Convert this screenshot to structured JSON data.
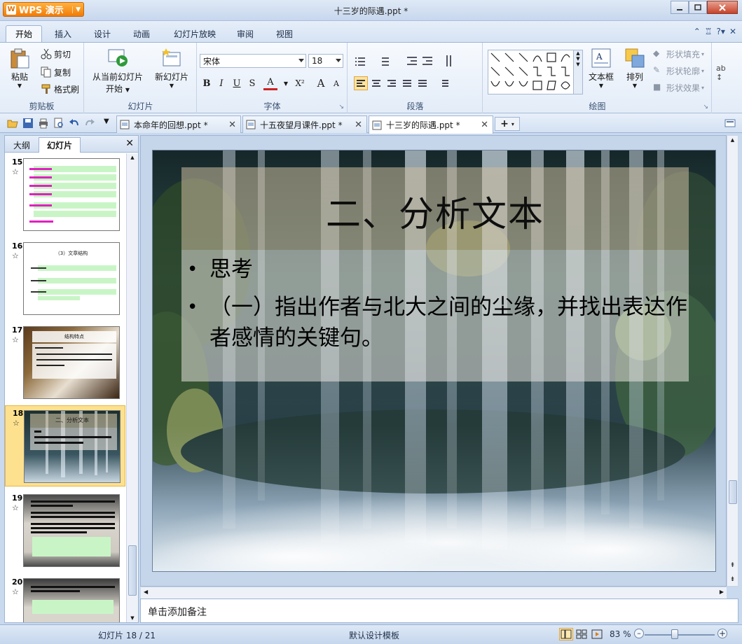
{
  "app": {
    "name": "WPS 演示",
    "logo_letter": "W",
    "window_title": "十三岁的际遇.ppt *"
  },
  "menu": {
    "tabs": [
      "开始",
      "插入",
      "设计",
      "动画",
      "幻灯片放映",
      "审阅",
      "视图"
    ],
    "active": "开始"
  },
  "ribbon": {
    "clipboard": {
      "paste": "粘贴",
      "cut": "剪切",
      "copy": "复制",
      "format_painter": "格式刷",
      "label": "剪贴板"
    },
    "slides": {
      "from_current": "从当前幻灯片",
      "from_current_2": "开始",
      "new_slide": "新幻灯片",
      "label": "幻灯片"
    },
    "font": {
      "name": "宋体",
      "size": "18",
      "label": "字体",
      "bold": "B",
      "italic": "I",
      "underline": "U",
      "shadow": "S",
      "color": "A",
      "superscript": "X²",
      "grow": "A",
      "shrink": "A"
    },
    "paragraph": {
      "label": "段落"
    },
    "drawing": {
      "textbox": "文本框",
      "arrange": "排列",
      "fill": "形状填充",
      "outline": "形状轮廓",
      "effects": "形状效果",
      "label": "绘图"
    }
  },
  "doc_tabs": [
    {
      "title": "本命年的回想.ppt *",
      "active": false
    },
    {
      "title": "十五夜望月课件.ppt *",
      "active": false
    },
    {
      "title": "十三岁的际遇.ppt *",
      "active": true
    }
  ],
  "panel": {
    "tabs": [
      "大纲",
      "幻灯片"
    ],
    "active": "幻灯片",
    "thumbnails": [
      {
        "number": "15",
        "selected": false
      },
      {
        "number": "16",
        "selected": false,
        "title": "（3）文章结构"
      },
      {
        "number": "17",
        "selected": false,
        "title": "结构特点"
      },
      {
        "number": "18",
        "selected": true,
        "title": "二、分析文本"
      },
      {
        "number": "19",
        "selected": false
      },
      {
        "number": "20",
        "selected": false
      }
    ]
  },
  "slide": {
    "title": "二、分析文本",
    "bullets": [
      "思考",
      "（一）指出作者与北大之间的尘缘，并找出表达作者感情的关键句。"
    ]
  },
  "notes": {
    "placeholder": "单击添加备注"
  },
  "status": {
    "slide_counter": "幻灯片 18 / 21",
    "template": "默认设计模板",
    "zoom": "83 %"
  },
  "colors": {
    "accent": "#f07b08",
    "selected_thumb": "#fde18f"
  }
}
